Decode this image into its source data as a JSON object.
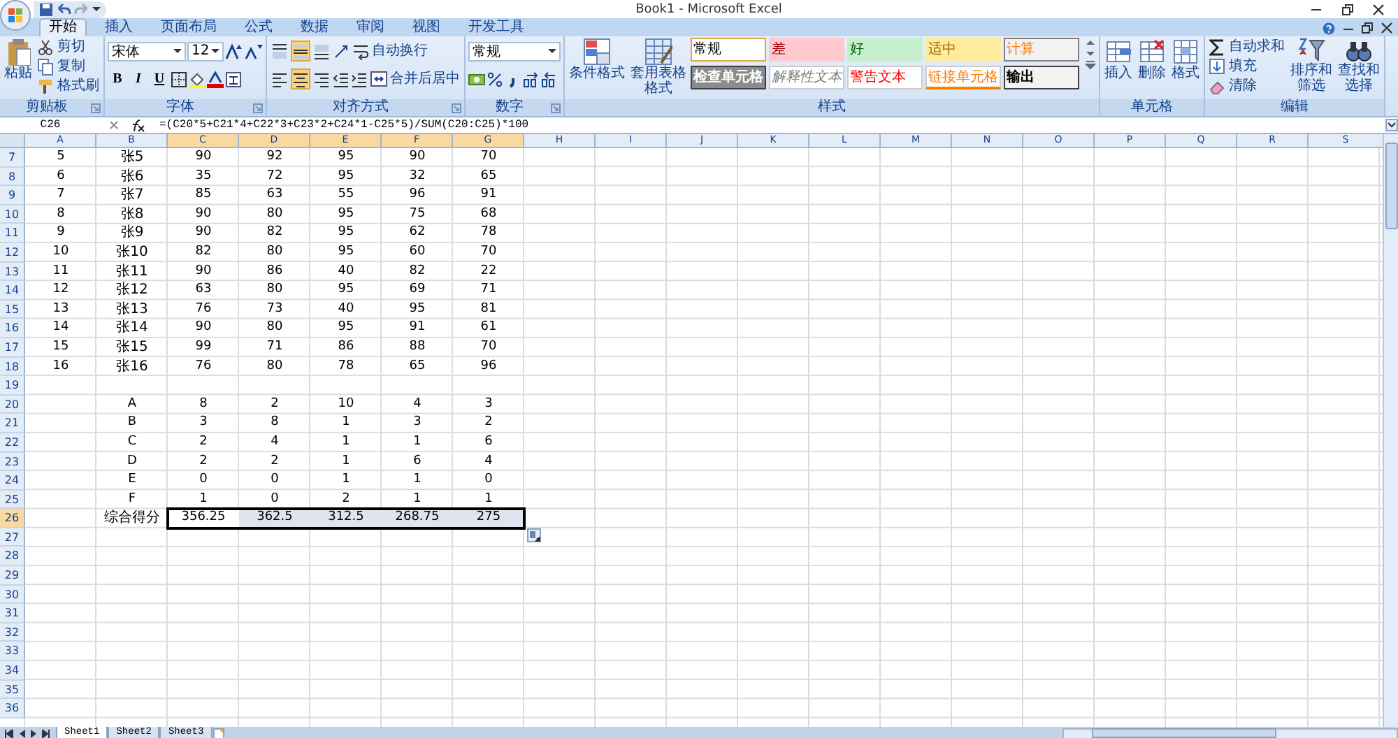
{
  "window": {
    "title": "Book1 - Microsoft Excel"
  },
  "tabs": [
    {
      "label": "开始",
      "selected": true
    },
    {
      "label": "插入",
      "selected": false
    },
    {
      "label": "页面布局",
      "selected": false
    },
    {
      "label": "公式",
      "selected": false
    },
    {
      "label": "数据",
      "selected": false
    },
    {
      "label": "审阅",
      "selected": false
    },
    {
      "label": "视图",
      "selected": false
    },
    {
      "label": "开发工具",
      "selected": false
    }
  ],
  "ribbon": {
    "groups": [
      {
        "kind": "clipboard",
        "label": "剪贴板",
        "paste": "粘贴",
        "commands": [
          "剪切",
          "复制",
          "格式刷"
        ]
      },
      {
        "kind": "font",
        "label": "字体",
        "font_name": "宋体",
        "font_size": "12",
        "style_buttons": [
          "B",
          "I",
          "U"
        ]
      },
      {
        "kind": "alignment",
        "label": "对齐方式",
        "wrap_text": "自动换行",
        "merge": "合并后居中",
        "vertical_align": [
          {
            "selected": false
          },
          {
            "selected": true
          },
          {
            "selected": false
          }
        ],
        "horizontal_align": [
          {
            "selected": false
          },
          {
            "selected": true
          },
          {
            "selected": false
          }
        ]
      },
      {
        "kind": "number",
        "label": "数字",
        "format": "常规"
      },
      {
        "kind": "styles",
        "label": "样式",
        "conditional": "条件格式",
        "table_format": "套用表格格式",
        "cell_styles": [
          {
            "label": "常规",
            "kind": "normal"
          },
          {
            "label": "差",
            "kind": "bad"
          },
          {
            "label": "好",
            "kind": "good"
          },
          {
            "label": "适中",
            "kind": "neutral"
          },
          {
            "label": "计算",
            "kind": "calculation"
          },
          {
            "label": "检查单元格",
            "kind": "check"
          },
          {
            "label": "解释性文本",
            "kind": "explanatory"
          },
          {
            "label": "警告文本",
            "kind": "warning"
          },
          {
            "label": "链接单元格",
            "kind": "linked"
          },
          {
            "label": "输出",
            "kind": "output"
          }
        ]
      },
      {
        "kind": "cells",
        "label": "单元格",
        "commands": [
          "插入",
          "删除",
          "格式"
        ]
      },
      {
        "kind": "editing",
        "label": "编辑",
        "small": [
          "自动求和",
          "填充",
          "清除"
        ],
        "large": [
          "排序和筛选",
          "查找和选择"
        ]
      }
    ]
  },
  "formula_bar": {
    "name_box": "C26",
    "formula": "=(C20*5+C21*4+C22*3+C23*2+C24*1-C25*5)/SUM(C20:C25)*100"
  },
  "sheet": {
    "columns": [
      {
        "label": "A",
        "selected": false
      },
      {
        "label": "B",
        "selected": false
      },
      {
        "label": "C",
        "selected": true
      },
      {
        "label": "D",
        "selected": true
      },
      {
        "label": "E",
        "selected": true
      },
      {
        "label": "F",
        "selected": true
      },
      {
        "label": "G",
        "selected": true
      },
      {
        "label": "H",
        "selected": false
      },
      {
        "label": "I",
        "selected": false
      },
      {
        "label": "J",
        "selected": false
      },
      {
        "label": "K",
        "selected": false
      },
      {
        "label": "L",
        "selected": false
      },
      {
        "label": "M",
        "selected": false
      },
      {
        "label": "N",
        "selected": false
      },
      {
        "label": "O",
        "selected": false
      },
      {
        "label": "P",
        "selected": false
      },
      {
        "label": "Q",
        "selected": false
      },
      {
        "label": "R",
        "selected": false
      },
      {
        "label": "S",
        "selected": false
      }
    ],
    "rows": [
      {
        "number": "7",
        "kind": "score",
        "selected": false,
        "cells": [
          "5",
          "张5",
          "90",
          "92",
          "95",
          "90",
          "70"
        ]
      },
      {
        "number": "8",
        "kind": "score",
        "selected": false,
        "cells": [
          "6",
          "张6",
          "35",
          "72",
          "95",
          "32",
          "65"
        ]
      },
      {
        "number": "9",
        "kind": "score",
        "selected": false,
        "cells": [
          "7",
          "张7",
          "85",
          "63",
          "55",
          "96",
          "91"
        ]
      },
      {
        "number": "10",
        "kind": "score",
        "selected": false,
        "cells": [
          "8",
          "张8",
          "90",
          "80",
          "95",
          "75",
          "68"
        ]
      },
      {
        "number": "11",
        "kind": "score",
        "selected": false,
        "cells": [
          "9",
          "张9",
          "90",
          "82",
          "95",
          "62",
          "78"
        ]
      },
      {
        "number": "12",
        "kind": "score",
        "selected": false,
        "cells": [
          "10",
          "张10",
          "82",
          "80",
          "95",
          "60",
          "70"
        ]
      },
      {
        "number": "13",
        "kind": "score",
        "selected": false,
        "cells": [
          "11",
          "张11",
          "90",
          "86",
          "40",
          "82",
          "22"
        ]
      },
      {
        "number": "14",
        "kind": "score",
        "selected": false,
        "cells": [
          "12",
          "张12",
          "63",
          "80",
          "95",
          "69",
          "71"
        ]
      },
      {
        "number": "15",
        "kind": "score",
        "selected": false,
        "cells": [
          "13",
          "张13",
          "76",
          "73",
          "40",
          "95",
          "81"
        ]
      },
      {
        "number": "16",
        "kind": "score",
        "selected": false,
        "cells": [
          "14",
          "张14",
          "90",
          "80",
          "95",
          "91",
          "61"
        ]
      },
      {
        "number": "17",
        "kind": "score",
        "selected": false,
        "cells": [
          "15",
          "张15",
          "99",
          "71",
          "86",
          "88",
          "70"
        ]
      },
      {
        "number": "18",
        "kind": "score",
        "selected": false,
        "cells": [
          "16",
          "张16",
          "76",
          "80",
          "78",
          "65",
          "96"
        ]
      },
      {
        "number": "19",
        "kind": "empty",
        "selected": false
      },
      {
        "number": "20",
        "kind": "summary",
        "selected": false,
        "cells": [
          "A",
          "8",
          "2",
          "10",
          "4",
          "3"
        ]
      },
      {
        "number": "21",
        "kind": "summary",
        "selected": false,
        "cells": [
          "B",
          "3",
          "8",
          "1",
          "3",
          "2"
        ]
      },
      {
        "number": "22",
        "kind": "summary",
        "selected": false,
        "cells": [
          "C",
          "2",
          "4",
          "1",
          "1",
          "6"
        ]
      },
      {
        "number": "23",
        "kind": "summary",
        "selected": false,
        "cells": [
          "D",
          "2",
          "2",
          "1",
          "6",
          "4"
        ]
      },
      {
        "number": "24",
        "kind": "summary",
        "selected": false,
        "cells": [
          "E",
          "0",
          "0",
          "1",
          "1",
          "0"
        ]
      },
      {
        "number": "25",
        "kind": "summary",
        "selected": false,
        "cells": [
          "F",
          "1",
          "0",
          "2",
          "1",
          "1"
        ]
      },
      {
        "number": "26",
        "kind": "summary",
        "selected": true,
        "cells": [
          "综合得分",
          "356.25",
          "362.5",
          "312.5",
          "268.75",
          "275"
        ]
      },
      {
        "number": "27",
        "kind": "empty",
        "selected": false
      },
      {
        "number": "28",
        "kind": "empty",
        "selected": false
      },
      {
        "number": "29",
        "kind": "empty",
        "selected": false
      },
      {
        "number": "30",
        "kind": "empty",
        "selected": false
      },
      {
        "number": "31",
        "kind": "empty",
        "selected": false
      },
      {
        "number": "32",
        "kind": "empty",
        "selected": false
      },
      {
        "number": "33",
        "kind": "empty",
        "selected": false
      },
      {
        "number": "34",
        "kind": "empty",
        "selected": false
      },
      {
        "number": "35",
        "kind": "empty",
        "selected": false
      },
      {
        "number": "36",
        "kind": "empty",
        "selected": false
      }
    ],
    "sheet_tabs": [
      {
        "label": "Sheet1",
        "selected": true
      },
      {
        "label": "Sheet2",
        "selected": false
      },
      {
        "label": "Sheet3",
        "selected": false
      }
    ]
  }
}
